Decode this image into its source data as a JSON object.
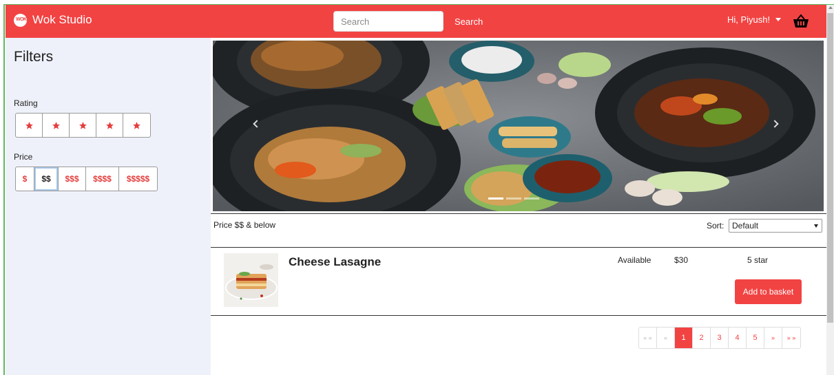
{
  "navbar": {
    "brand_name": "Wok Studio",
    "logo_text": "WOK",
    "search_placeholder": "Search",
    "search_label": "Search",
    "user_greeting": "Hi, Piyush!",
    "basket_icon": "basket-icon",
    "color": "#f24343"
  },
  "sidebar": {
    "title": "Filters",
    "rating_label": "Rating",
    "ratings": [
      "1",
      "2",
      "3",
      "4",
      "5"
    ],
    "price_label": "Price",
    "prices": [
      "$",
      "$$",
      "$$$",
      "$$$$",
      "$$$$$"
    ],
    "selected_price": "$$"
  },
  "filter_bar": {
    "price_summary": "Price $$ & below",
    "sort_label": "Sort:",
    "sort_value": "Default"
  },
  "products": [
    {
      "name": "Cheese Lasagne",
      "availability": "Available",
      "price": "$30",
      "rating": "5 star",
      "button_label": "Add to basket"
    }
  ],
  "pagination": {
    "first": "« «",
    "prev": "«",
    "pages": [
      "1",
      "2",
      "3",
      "4",
      "5"
    ],
    "active": "1",
    "next": "»",
    "last": "» »"
  },
  "colors": {
    "accent": "#f24343",
    "sidebar_bg": "#eff1fa"
  }
}
